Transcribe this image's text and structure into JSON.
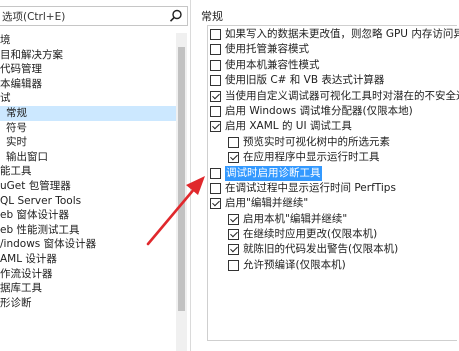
{
  "search": {
    "value": "选项(Ctrl+E)"
  },
  "tree": [
    {
      "label": "境",
      "indent": 0,
      "selected": false
    },
    {
      "label": "目和解决方案",
      "indent": 0,
      "selected": false
    },
    {
      "label": "代码管理",
      "indent": 0,
      "selected": false
    },
    {
      "label": "本编辑器",
      "indent": 0,
      "selected": false
    },
    {
      "label": "试",
      "indent": 0,
      "selected": false
    },
    {
      "label": "常规",
      "indent": 1,
      "selected": true
    },
    {
      "label": "符号",
      "indent": 1,
      "selected": false
    },
    {
      "label": "实时",
      "indent": 1,
      "selected": false
    },
    {
      "label": "输出窗口",
      "indent": 1,
      "selected": false
    },
    {
      "label": "能工具",
      "indent": 0,
      "selected": false
    },
    {
      "label": "uGet 包管理器",
      "indent": 0,
      "selected": false
    },
    {
      "label": "QL Server Tools",
      "indent": 0,
      "selected": false
    },
    {
      "label": "eb 窗体设计器",
      "indent": 0,
      "selected": false
    },
    {
      "label": "eb 性能测试工具",
      "indent": 0,
      "selected": false
    },
    {
      "label": "/indows 窗体设计器",
      "indent": 0,
      "selected": false
    },
    {
      "label": "AML 设计器",
      "indent": 0,
      "selected": false
    },
    {
      "label": "作流设计器",
      "indent": 0,
      "selected": false
    },
    {
      "label": "据库工具",
      "indent": 0,
      "selected": false
    },
    {
      "label": "形诊断",
      "indent": 0,
      "selected": false
    }
  ],
  "section_title": "常规",
  "options": [
    {
      "label": "如果写入的数据未更改值，则忽略 GPU 内存访问异",
      "checked": false,
      "indent": 0,
      "highlighted": false
    },
    {
      "label": "使用托管兼容模式",
      "checked": false,
      "indent": 0,
      "highlighted": false
    },
    {
      "label": "使用本机兼容性模式",
      "checked": false,
      "indent": 0,
      "highlighted": false
    },
    {
      "label": "使用旧版 C# 和 VB 表达式计算器",
      "checked": false,
      "indent": 0,
      "highlighted": false
    },
    {
      "label": "当使用自定义调试器可视化工具时对潜在的不安全进",
      "checked": true,
      "indent": 0,
      "highlighted": false
    },
    {
      "label": "启用 Windows 调试堆分配器(仅限本地)",
      "checked": false,
      "indent": 0,
      "highlighted": false
    },
    {
      "label": "启用 XAML 的 UI 调试工具",
      "checked": true,
      "indent": 0,
      "highlighted": false
    },
    {
      "label": "预览实时可视化树中的所选元素",
      "checked": false,
      "indent": 1,
      "highlighted": false
    },
    {
      "label": "在应用程序中显示运行时工具",
      "checked": true,
      "indent": 1,
      "highlighted": false
    },
    {
      "label": "调试时启用诊断工具",
      "checked": false,
      "indent": 0,
      "highlighted": true
    },
    {
      "label": "在调试过程中显示运行时间 PerfTips",
      "checked": false,
      "indent": 0,
      "highlighted": false
    },
    {
      "label": "启用\"编辑并继续\"",
      "checked": true,
      "indent": 0,
      "highlighted": false
    },
    {
      "label": "启用本机\"编辑并继续\"",
      "checked": true,
      "indent": 1,
      "highlighted": false
    },
    {
      "label": "在继续时应用更改(仅限本机)",
      "checked": true,
      "indent": 1,
      "highlighted": false
    },
    {
      "label": "就陈旧的代码发出警告(仅限本机)",
      "checked": true,
      "indent": 1,
      "highlighted": false
    },
    {
      "label": "允许预编译(仅限本机)",
      "checked": false,
      "indent": 1,
      "highlighted": false
    }
  ],
  "icons": {
    "search": "search-icon",
    "annotation": "red-arrow-annotation"
  },
  "colors": {
    "selection": "#cce8ff",
    "highlight": "#3399ff",
    "arrow": "#e0282c"
  }
}
